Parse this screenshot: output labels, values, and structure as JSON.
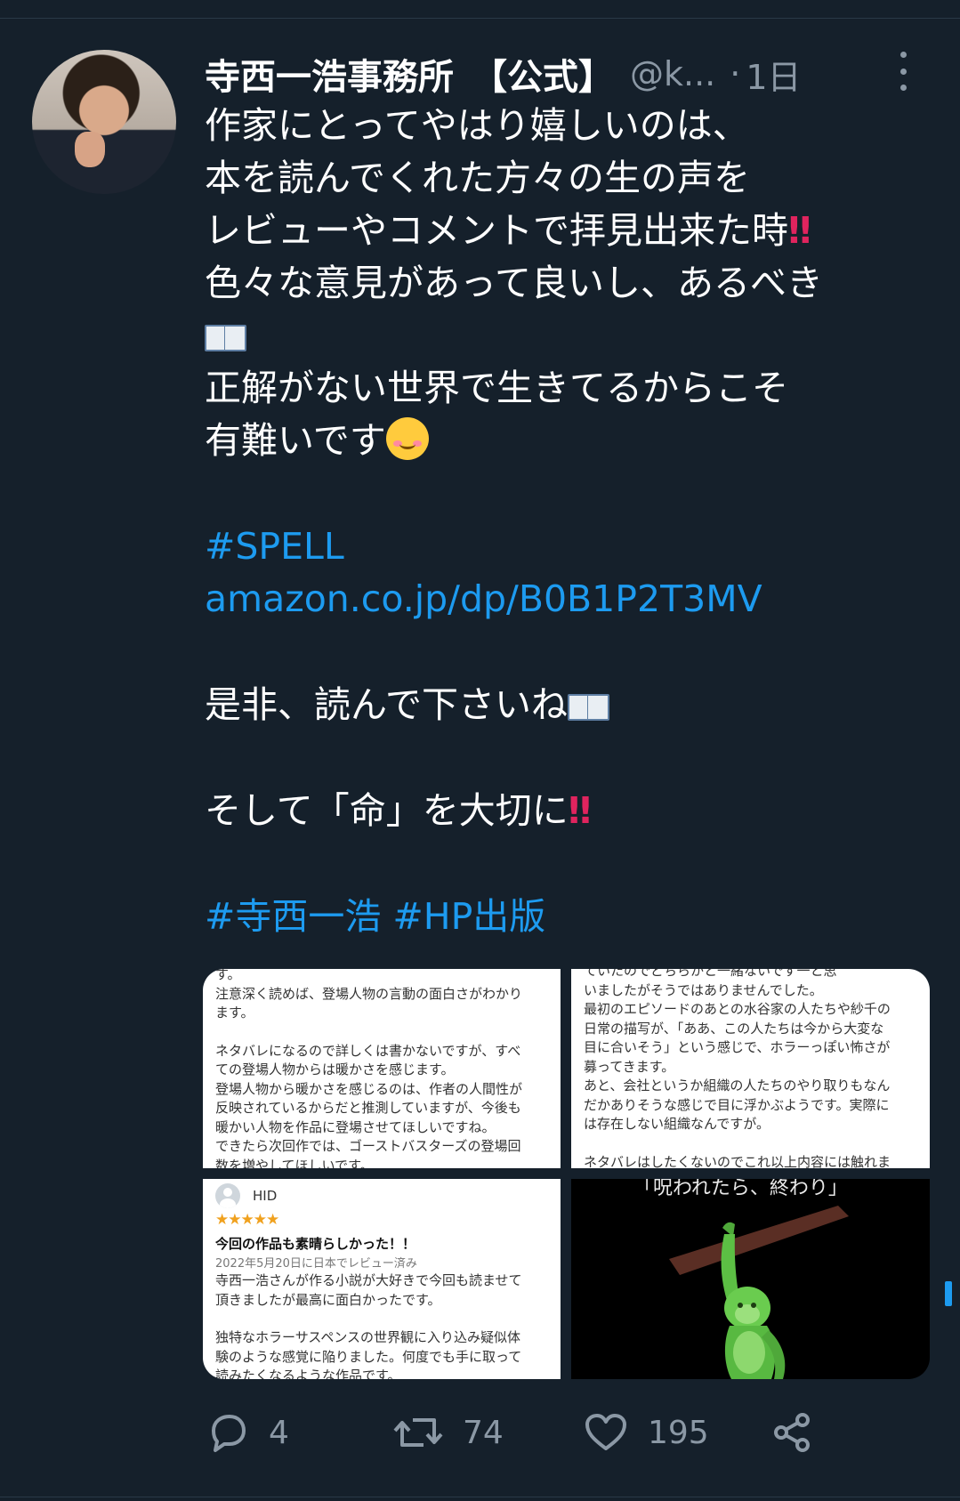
{
  "tweet": {
    "author_name": "寺西一浩事務所　【公式】",
    "handle": "@k...",
    "separator": "·",
    "time": "1日",
    "lines": [
      "作家にとってやはり嬉しいのは、",
      "本を読んでくれた方々の生の声を",
      "レビューやコメントで拝見出来た時",
      "色々な意見があって良いし、あるべき",
      "正解がない世界で生きてるからこそ",
      "有難いです"
    ],
    "hashtag_spell": "#SPELL",
    "link": "amazon.co.jp/dp/B0B1P2T3MV",
    "line_read": "是非、読んで下さいね",
    "line_life": "そして「命」を大切に",
    "hashtags_bottom": "#寺西一浩 #HP出版",
    "emoji_bang": "‼",
    "icons": {
      "avatar": "author-avatar",
      "more": "more-vertical-icon",
      "book": "open-book-emoji",
      "smile": "smiling-face-emoji",
      "reply": "reply-icon",
      "retweet": "retweet-icon",
      "like": "heart-icon",
      "share": "share-icon"
    }
  },
  "media": {
    "image1": [
      "す。",
      "注意深く読めば、登場人物の言動の面白さがわかり",
      "ます。",
      "",
      "ネタバレになるので詳しくは書かないですが、すべ",
      "ての登場人物からは暖かさを感じます。",
      "登場人物から暖かさを感じるのは、作者の人間性が",
      "反映されているからだと推測していますが、今後も",
      "暖かい人物を作品に登場させてほしいですね。",
      "できたら次回作では、ゴーストバスターズの登場回",
      "数を増やしてほしいです。"
    ],
    "image2": [
      "ていたのでどちらかと一緒ないです一と思",
      "いましたがそうではありませんでした。",
      "最初のエピソードのあとの水谷家の人たちや紗千の",
      "日常の描写が、「ああ、この人たちは今から大変な",
      "目に合いそう」という感じで、ホラーっぽい怖さが",
      "募ってきます。",
      "あと、会社というか組織の人たちのやり取りもなん",
      "だかありそうな感じで目に浮かぶようです。実際に",
      "は存在しない組織なんですが。",
      "",
      "ネタバレはしたくないのでこれ以上内容には触れま"
    ],
    "image3": {
      "reviewer": "HID",
      "stars": "★★★★★",
      "title": "今回の作品も素晴らしかった！！",
      "date": "2022年5月20日に日本でレビュー済み",
      "text": [
        "寺西一浩さんが作る小説が大好きで今回も読ませて",
        "頂きましたが最高に面白かったです。",
        "",
        "独特なホラーサスペンスの世界観に入り込み疑似体",
        "験のような感覚に陥りました。何度でも手に取って",
        "読みたくなるような作品です。"
      ]
    },
    "image4": {
      "caption": "「呪われたら、終わり」"
    }
  },
  "actions": {
    "replies": "4",
    "retweets": "74",
    "likes": "195"
  },
  "colors": {
    "background": "#15202b",
    "text": "#ffffff",
    "secondary": "#8b98a5",
    "link": "#1d9bf0",
    "accent_red": "#e0245e"
  }
}
